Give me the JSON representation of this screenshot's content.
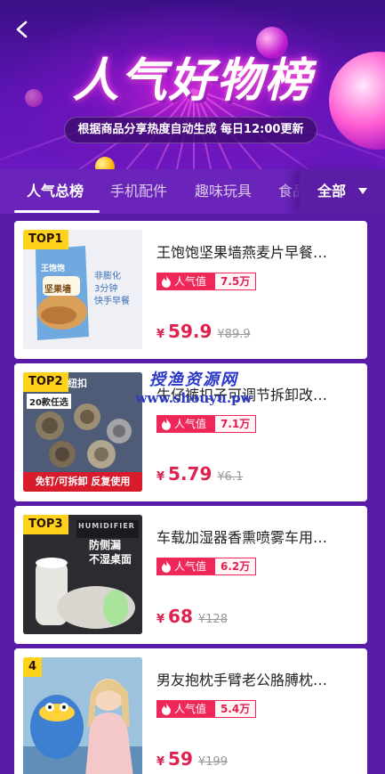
{
  "header": {
    "title": "人气好物榜",
    "subtitle": "根据商品分享热度自动生成   每日12:00更新"
  },
  "tabs": [
    {
      "label": "人气总榜",
      "active": true
    },
    {
      "label": "手机配件",
      "active": false
    },
    {
      "label": "趣味玩具",
      "active": false
    },
    {
      "label": "食品",
      "active": false
    }
  ],
  "filter": {
    "label": "全部"
  },
  "hot_label": "人气值",
  "currency": "¥",
  "products": [
    {
      "rank": "TOP1",
      "title": "王饱饱坚果墙燕麦片早餐…",
      "hot": "7.5万",
      "price": "59.9",
      "original_price": "¥89.9",
      "image_text": {
        "brand": "王饱饱",
        "line1": "非膨化",
        "line2": "3分钟",
        "line3": "快手早餐",
        "bag": "坚果墙"
      }
    },
    {
      "rank": "TOP2",
      "title": "牛仔裤扣子可调节拆卸改…",
      "hot": "7.1万",
      "price": "5.79",
      "original_price": "¥6.1",
      "image_text": {
        "tag1": "20款任选",
        "tag2": "纽扣",
        "bottom": "免钉/可拆卸 反复使用"
      }
    },
    {
      "rank": "TOP3",
      "title": "车载加湿器香熏喷雾车用…",
      "hot": "6.2万",
      "price": "68",
      "original_price": "¥128",
      "image_text": {
        "line1": "防侧漏",
        "line2": "不湿桌面",
        "brand": "HUMIDIFIER"
      }
    },
    {
      "rank": "4",
      "title": "男友抱枕手臂老公胳膊枕…",
      "hot": "5.4万",
      "price": "59",
      "original_price": "¥199",
      "image_text": {}
    }
  ],
  "watermark": {
    "cn": "授渔资源网",
    "url": "www.shouyu.pw"
  },
  "colors": {
    "accent": "#f0285a",
    "background": "#5a1aa8",
    "rank_badge": "#ffd21c"
  }
}
